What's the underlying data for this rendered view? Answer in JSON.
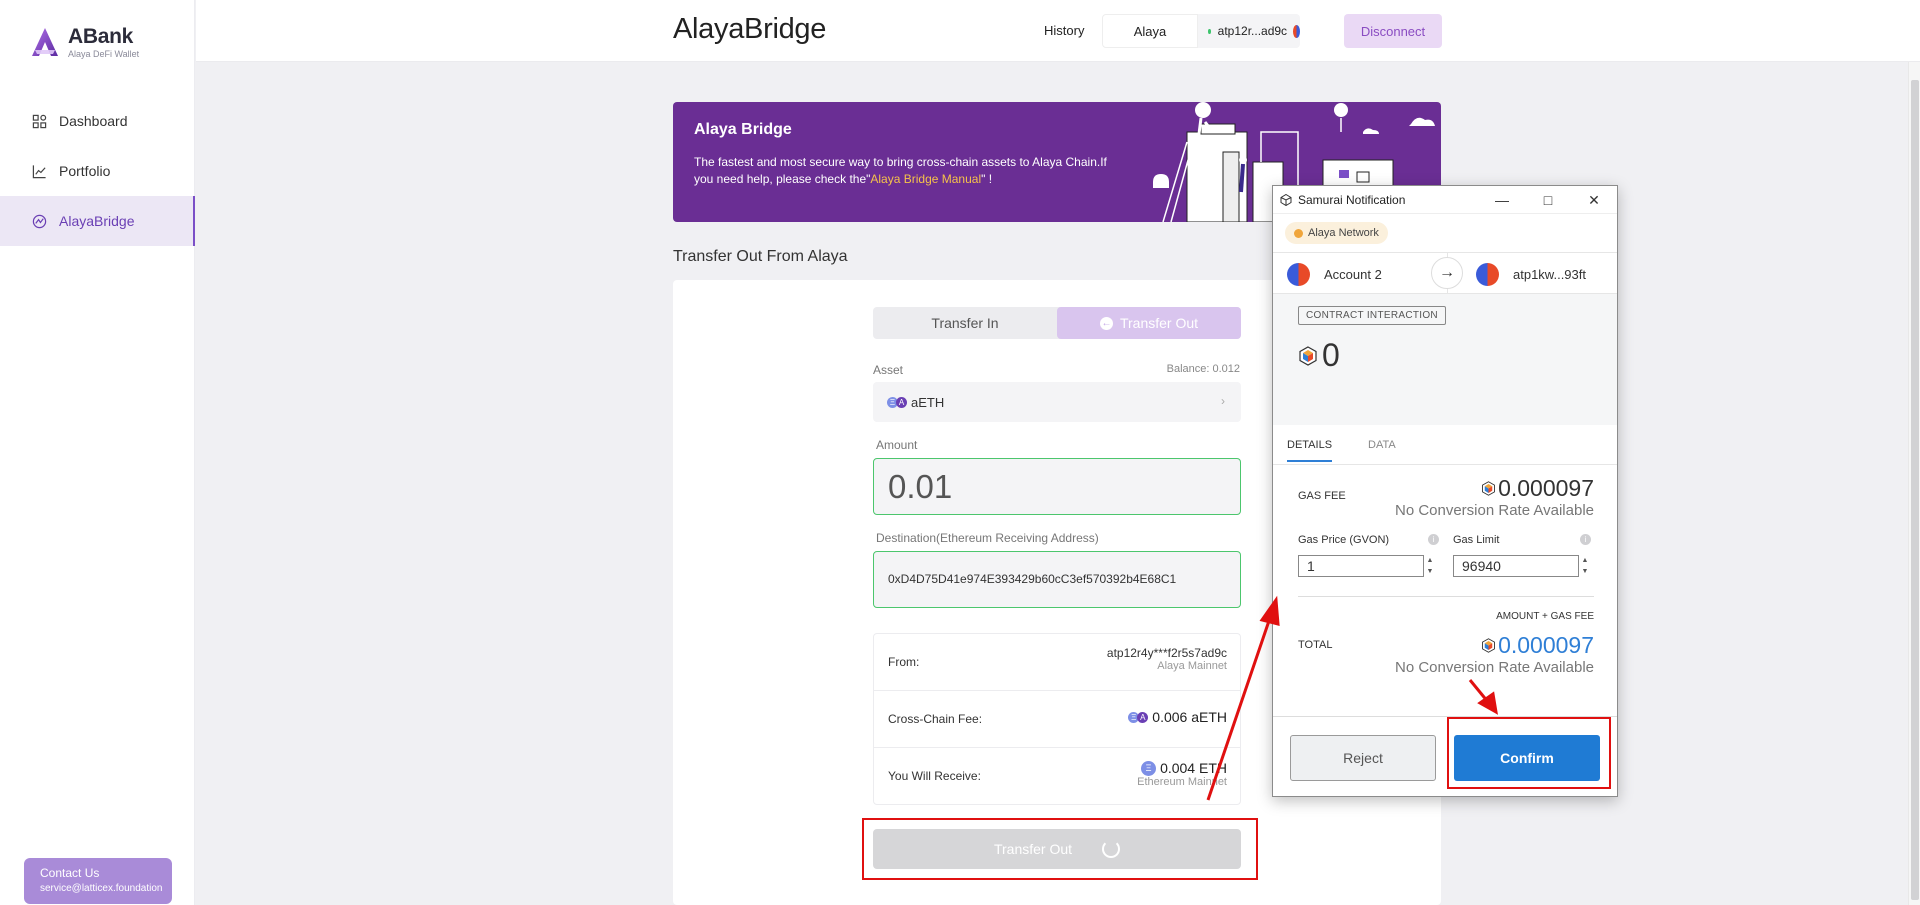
{
  "sidebar": {
    "brand": "ABank",
    "tagline": "Alaya DeFi Wallet",
    "items": [
      {
        "label": "Dashboard",
        "icon": "grid-icon"
      },
      {
        "label": "Portfolio",
        "icon": "chart-line-icon"
      },
      {
        "label": "AlayaBridge",
        "icon": "bridge-icon",
        "active": true
      }
    ],
    "contact": {
      "title": "Contact Us",
      "email": "service@latticex.foundation"
    }
  },
  "header": {
    "title": "AlayaBridge",
    "history": "History",
    "network": "Alaya",
    "account": "atp12r...ad9c",
    "disconnect": "Disconnect"
  },
  "banner": {
    "title": "Alaya Bridge",
    "text_pre": "The fastest and most secure way to bring cross-chain assets to Alaya Chain.If you need help, please check the\"",
    "link": "Alaya Bridge Manual",
    "text_post": "\" !"
  },
  "section_title": "Transfer Out From Alaya",
  "form": {
    "tab_in": "Transfer In",
    "tab_out": "Transfer Out",
    "asset_label": "Asset",
    "balance": "Balance: 0.012",
    "asset": "aETH",
    "amount_label": "Amount",
    "amount": "0.01",
    "dest_label": "Destination(Ethereum Receiving Address)",
    "dest": "0xD4D75D41e974E393429b60cC3ef570392b4E68C1",
    "from_label": "From:",
    "from_addr": "atp12r4y***f2r5s7ad9c",
    "from_net": "Alaya Mainnet",
    "fee_label": "Cross-Chain Fee:",
    "fee": "0.006 aETH",
    "receive_label": "You Will Receive:",
    "receive": "0.004 ETH",
    "receive_net": "Ethereum Mainnet",
    "submit": "Transfer Out"
  },
  "popup": {
    "title": "Samurai Notification",
    "network": "Alaya Network",
    "from_account": "Account 2",
    "to_account": "atp1kw...93ft",
    "tag": "CONTRACT INTERACTION",
    "value": "0",
    "tab_details": "DETAILS",
    "tab_data": "DATA",
    "gas_fee_label": "GAS FEE",
    "gas_fee": "0.000097",
    "no_rate": "No Conversion Rate Available",
    "gas_price_label": "Gas Price (GVON)",
    "gas_price": "1",
    "gas_limit_label": "Gas Limit",
    "gas_limit": "96940",
    "amount_gas_label": "AMOUNT + GAS FEE",
    "total_label": "TOTAL",
    "total": "0.000097",
    "no_rate_total": "No Conversion Rate Available",
    "reject": "Reject",
    "confirm": "Confirm"
  },
  "colors": {
    "brand": "#6a2e94",
    "accent": "#7b4fc7",
    "valid": "#4cc66d",
    "confirm": "#1f7bd4",
    "highlight": "#e01010"
  }
}
